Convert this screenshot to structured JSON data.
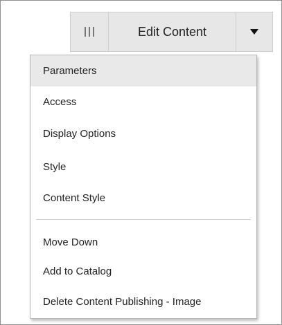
{
  "toolbar": {
    "handle_icon": "drag-handle-icon",
    "edit_label": "Edit Content",
    "dropdown_icon": "caret-down-icon"
  },
  "menu": {
    "highlighted_item": "Parameters",
    "group1": [
      "Parameters",
      "Access",
      "Display Options",
      "Style",
      "Content Style"
    ],
    "group2": [
      "Move Down",
      "Add to Catalog",
      "Delete Content Publishing - Image"
    ]
  },
  "colors": {
    "toolbar_bg": "#e7e7e7",
    "highlight_bg": "#e9e9e9",
    "text": "#222222"
  }
}
